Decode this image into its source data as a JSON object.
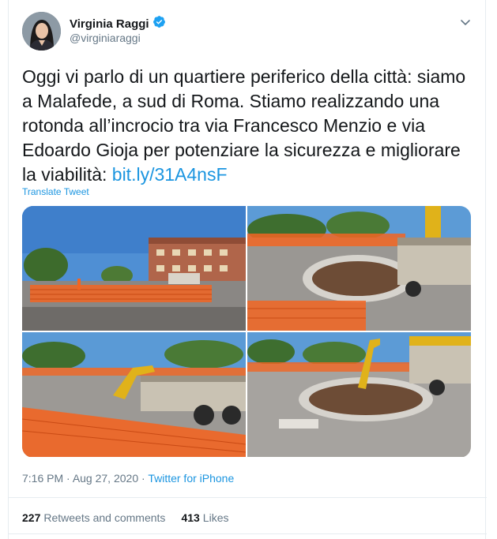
{
  "user": {
    "name": "Virginia Raggi",
    "handle": "@virginiaraggi",
    "verified": true
  },
  "tweet": {
    "text_before_link": "Oggi vi parlo di un quartiere periferico della città: siamo a Malafede, a sud di Roma. Stiamo realizzando una rotonda all’incrocio tra via Francesco Menzio e via Edoardo Gioja per potenziare la sicurezza e migliorare la viabilità: ",
    "link": "bit.ly/31A4nsF",
    "translate_label": "Translate Tweet"
  },
  "media": [
    {
      "name": "photo-1",
      "subject": "street with apartment building and orange fence"
    },
    {
      "name": "photo-2",
      "subject": "roundabout construction with truck"
    },
    {
      "name": "photo-3",
      "subject": "excavator and truck behind orange fence"
    },
    {
      "name": "photo-4",
      "subject": "excavator working on roundabout"
    }
  ],
  "meta": {
    "time": "7:16 PM",
    "separator": " · ",
    "date": "Aug 27, 2020",
    "source": "Twitter for iPhone"
  },
  "stats": {
    "retweets_count": "227",
    "retweets_label": "Retweets and comments",
    "likes_count": "413",
    "likes_label": "Likes"
  },
  "colors": {
    "link": "#1b95e0",
    "secondary": "#657786",
    "verified": "#1da1f2",
    "fence": "#f26522"
  },
  "icons": [
    "verified-badge-icon",
    "chevron-down-icon"
  ]
}
